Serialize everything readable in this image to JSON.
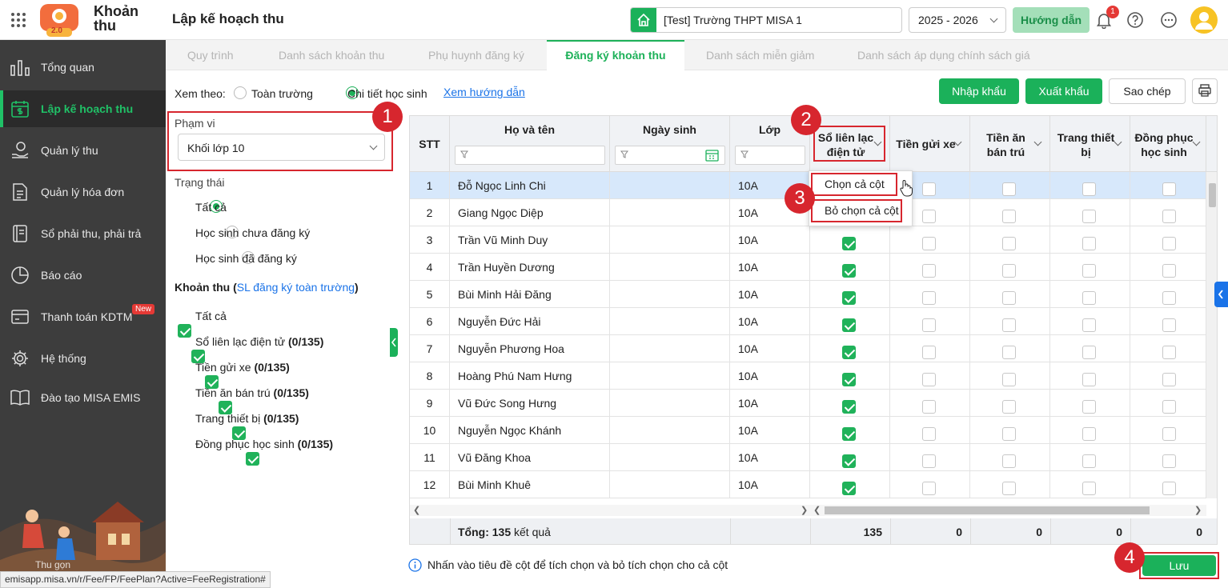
{
  "app": {
    "logo_line1": "Khoản",
    "logo_line2": "thu",
    "page_title": "Lập kế hoạch thu",
    "logo_badge": "2.0"
  },
  "header": {
    "school": "[Test] Trường THPT MISA 1",
    "year": "2025 - 2026",
    "guide_button": "Hướng dẫn",
    "notification_count": "1"
  },
  "sidebar": {
    "items": [
      {
        "label": "Tổng quan",
        "icon": "chart-bars-icon"
      },
      {
        "label": "Lập kế hoạch thu",
        "icon": "calendar-dollar-icon",
        "active": true
      },
      {
        "label": "Quản lý thu",
        "icon": "hand-coin-icon"
      },
      {
        "label": "Quản lý hóa đơn",
        "icon": "invoice-icon"
      },
      {
        "label": "Sổ phải thu, phải trả",
        "icon": "ledger-icon"
      },
      {
        "label": "Báo cáo",
        "icon": "pie-chart-icon"
      },
      {
        "label": "Thanh toán KDTM",
        "icon": "payment-icon",
        "badge": "New"
      },
      {
        "label": "Hệ thống",
        "icon": "gear-icon"
      },
      {
        "label": "Đào tạo MISA EMIS",
        "icon": "book-icon"
      }
    ],
    "bottom_text": "Thu gọn"
  },
  "tabs": [
    "Quy trình",
    "Danh sách khoản thu",
    "Phụ huynh đăng ký",
    "Đăng ký khoản thu",
    "Danh sách miễn giảm",
    "Danh sách áp dụng chính sách giá"
  ],
  "view": {
    "label": "Xem theo:",
    "opt1": "Toàn trường",
    "opt2": "Chi tiết học sinh",
    "guide_link": "Xem hướng dẫn"
  },
  "actions": {
    "import": "Nhập khẩu",
    "export": "Xuất khẩu",
    "copy": "Sao chép"
  },
  "filters": {
    "scope_label": "Phạm vi",
    "scope_value": "Khối lớp 10",
    "status_label": "Trạng thái",
    "status_options": [
      "Tất cả",
      "Học sinh chưa đăng ký",
      "Học sinh đã đăng ký"
    ],
    "fees_label": "Khoản thu",
    "fees_link": "SL đăng ký toàn trường",
    "fees": [
      {
        "name": "Tất cả",
        "count": ""
      },
      {
        "name": "Sổ liên lạc điện tử",
        "count": "(0/135)"
      },
      {
        "name": "Tiền gửi xe",
        "count": "(0/135)"
      },
      {
        "name": "Tiền ăn bán trú",
        "count": "(0/135)"
      },
      {
        "name": "Trang thiết bị",
        "count": "(0/135)"
      },
      {
        "name": "Đồng phục học sinh",
        "count": "(0/135)"
      }
    ]
  },
  "table": {
    "headers": {
      "stt": "STT",
      "name": "Họ và tên",
      "dob": "Ngày sinh",
      "class": "Lớp",
      "c1a": "Sổ liên lạc",
      "c1b": "điện tử",
      "c2": "Tiền gửi xe",
      "c3a": "Tiền ăn",
      "c3b": "bán trú",
      "c4a": "Trang thiết",
      "c4b": "bị",
      "c5a": "Đồng phục",
      "c5b": "học sinh"
    },
    "rows": [
      {
        "stt": "1",
        "name": "Đỗ Ngọc Linh Chi",
        "class": "10A",
        "c1": false
      },
      {
        "stt": "2",
        "name": "Giang Ngọc Diệp",
        "class": "10A",
        "c1": false
      },
      {
        "stt": "3",
        "name": "Trần Vũ Minh Duy",
        "class": "10A",
        "c1": true
      },
      {
        "stt": "4",
        "name": "Trần Huyền Dương",
        "class": "10A",
        "c1": true
      },
      {
        "stt": "5",
        "name": "Bùi Minh Hải Đăng",
        "class": "10A",
        "c1": true
      },
      {
        "stt": "6",
        "name": "Nguyễn Đức Hải",
        "class": "10A",
        "c1": true
      },
      {
        "stt": "7",
        "name": "Nguyễn Phương Hoa",
        "class": "10A",
        "c1": true
      },
      {
        "stt": "8",
        "name": "Hoàng Phú Nam Hưng",
        "class": "10A",
        "c1": true
      },
      {
        "stt": "9",
        "name": "Vũ Đức Song Hưng",
        "class": "10A",
        "c1": true
      },
      {
        "stt": "10",
        "name": "Nguyễn Ngọc Khánh",
        "class": "10A",
        "c1": true
      },
      {
        "stt": "11",
        "name": "Vũ Đăng Khoa",
        "class": "10A",
        "c1": true
      },
      {
        "stt": "12",
        "name": "Bùi Minh Khuê",
        "class": "10A",
        "c1": true
      }
    ],
    "footer": {
      "total_label": "Tổng:",
      "total_count": "135",
      "total_suffix": "kết quả",
      "c1": "135",
      "c2": "0",
      "c3": "0",
      "c4": "0",
      "c5": "0"
    }
  },
  "context_menu": {
    "select_all": "Chọn cả cột",
    "deselect_all": "Bỏ chọn cả cột"
  },
  "hint": "Nhấn vào tiêu đề cột để tích chọn và bỏ tích chọn cho cả cột",
  "save": "Lưu",
  "callouts": [
    "1",
    "2",
    "3",
    "4"
  ],
  "status_url": "emisapp.misa.vn/r/Fee/FP/FeePlan?Active=FeeRegistration#"
}
